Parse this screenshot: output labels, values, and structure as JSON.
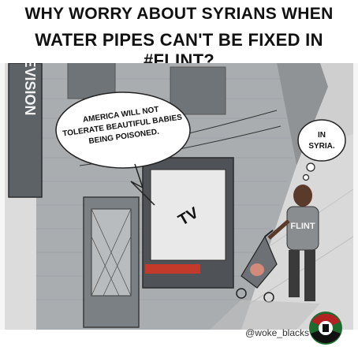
{
  "title": {
    "line1": "WHY WORRY ABOUT SYRIANS WHEN",
    "line2": "WATER PIPES CAN'T BE FIXED IN #FLINT?"
  },
  "cartoon": {
    "building_sign": "EVISION",
    "tv_speech": [
      "AMERICA WILL NOT",
      "TOLERATE BEAUTIFUL BABIES",
      "BEING POISONED."
    ],
    "tv_label": "TV",
    "thought": [
      "IN",
      "SYRIA."
    ],
    "shirt_text": "FLINT"
  },
  "credit": "@woke_blacks",
  "colors": {
    "wall": "#a8acae",
    "sidewalk": "#d7d7d7",
    "window_red": "#c43a2a",
    "seal_green": "#1f6b2e",
    "seal_red": "#b22222"
  }
}
